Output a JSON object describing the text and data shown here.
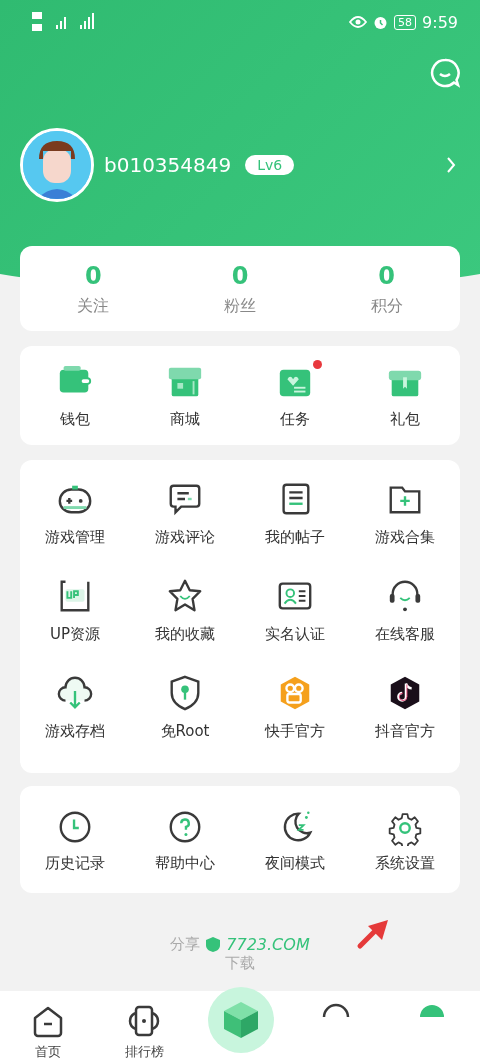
{
  "status_bar": {
    "battery": "58",
    "time": "9:59"
  },
  "profile": {
    "username": "b010354849",
    "level_badge": "Lv6"
  },
  "stats": [
    {
      "value": "0",
      "label": "关注"
    },
    {
      "value": "0",
      "label": "粉丝"
    },
    {
      "value": "0",
      "label": "积分"
    }
  ],
  "quick_actions": [
    {
      "label": "钱包",
      "dot": false
    },
    {
      "label": "商城",
      "dot": false
    },
    {
      "label": "任务",
      "dot": true
    },
    {
      "label": "礼包",
      "dot": false
    }
  ],
  "features": [
    {
      "label": "游戏管理"
    },
    {
      "label": "游戏评论"
    },
    {
      "label": "我的帖子"
    },
    {
      "label": "游戏合集"
    },
    {
      "label": "UP资源"
    },
    {
      "label": "我的收藏"
    },
    {
      "label": "实名认证"
    },
    {
      "label": "在线客服"
    },
    {
      "label": "游戏存档"
    },
    {
      "label": "免Root"
    },
    {
      "label": "快手官方"
    },
    {
      "label": "抖音官方"
    }
  ],
  "tools": [
    {
      "label": "历史记录"
    },
    {
      "label": "帮助中心"
    },
    {
      "label": "夜间模式"
    },
    {
      "label": "系统设置"
    }
  ],
  "share": {
    "prefix": "分享",
    "site": "7723.COM",
    "line_2": "下载"
  },
  "bottom_nav": [
    {
      "label": "首页"
    },
    {
      "label": "排行榜"
    }
  ]
}
